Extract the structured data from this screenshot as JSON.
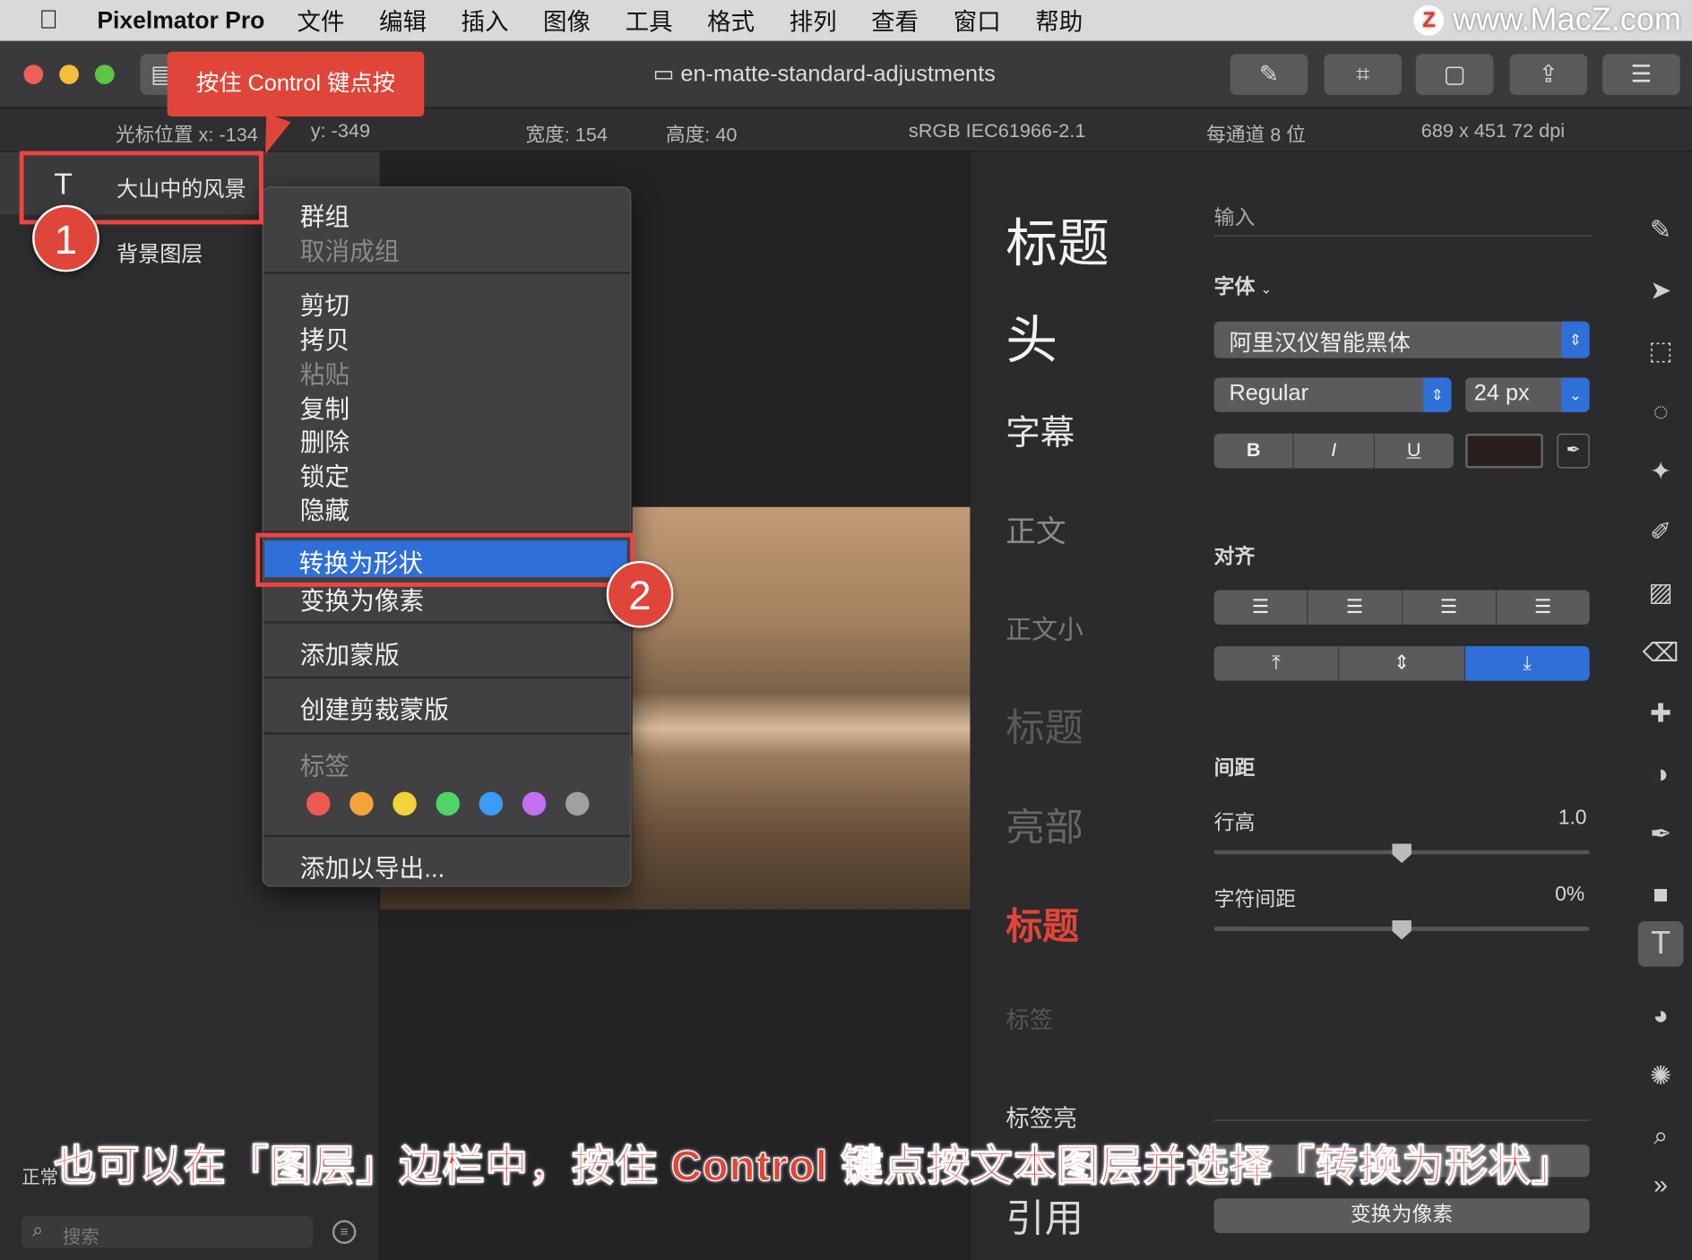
{
  "menubar": {
    "app": "Pixelmator Pro",
    "items": [
      "文件",
      "编辑",
      "插入",
      "图像",
      "工具",
      "格式",
      "排列",
      "查看",
      "窗口",
      "帮助"
    ]
  },
  "watermark": "www.MacZ.com",
  "window": {
    "title": "en-matte-standard-adjustments"
  },
  "infobar": {
    "cursor_x": "光标位置 x:  -134",
    "cursor_y": "y:  -349",
    "width": "宽度:  154",
    "height": "高度:  40",
    "colorspace": "sRGB IEC61966-2.1",
    "bits": "每通道 8 位",
    "size": "689 x 451 72 dpi"
  },
  "layers": {
    "items": [
      {
        "name": "大山中的风景",
        "icon": "T"
      },
      {
        "name": "背景图层"
      }
    ],
    "blend_label": "正常",
    "search_placeholder": "搜索"
  },
  "callout": "按住 Control 键点按",
  "step1": "1",
  "step2": "2",
  "context_menu": {
    "group": "群组",
    "ungroup": "取消成组",
    "cut": "剪切",
    "copy": "拷贝",
    "paste": "粘贴",
    "duplicate": "复制",
    "delete": "删除",
    "lock": "锁定",
    "hide": "隐藏",
    "convert_shape": "转换为形状",
    "convert_pixels": "变换为像素",
    "add_mask": "添加蒙版",
    "clip_mask": "创建剪裁蒙版",
    "tags": "标签",
    "export": "添加以导出...",
    "tag_colors": [
      "#ee5a52",
      "#f5a23a",
      "#f4d23a",
      "#4fd467",
      "#3a9cf4",
      "#c46ef0",
      "#a0a0a4"
    ]
  },
  "styles": {
    "items": [
      "标题",
      "头",
      "字幕",
      "正文",
      "正文小",
      "标题",
      "亮部",
      "标题",
      "标签",
      "标签亮",
      "引用"
    ]
  },
  "props": {
    "input_label": "输入",
    "font_label": "字体",
    "font_name": "阿里汉仪智能黑体",
    "weight": "Regular",
    "size": "24 px",
    "bold": "B",
    "italic": "I",
    "underline": "U",
    "text_color": "#2a1f1c",
    "align_label": "对齐",
    "spacing_label": "间距",
    "line_height_label": "行高",
    "line_height": "1.0",
    "char_spacing_label": "字符间距",
    "char_spacing": "0%",
    "convert_pixels_btn": "变换为像素",
    "line_height_slider": 0.5,
    "char_spacing_slider": 0.5
  },
  "caption": "也可以在「图层」边栏中，按住 Control 键点按文本图层并选择「转换为形状」"
}
